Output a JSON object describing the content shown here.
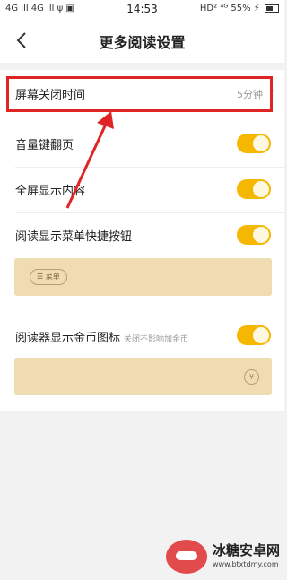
{
  "status_bar": {
    "left": "4G ıll 4G ıll ψ ▣",
    "time": "14:53",
    "right": "HD² ⁴ᴳ 55% ⚡",
    "battery_level_percent": 55
  },
  "header": {
    "title": "更多阅读设置",
    "back_icon": "chevron-left-icon"
  },
  "settings": {
    "screen_off": {
      "label": "屏幕关闭时间",
      "value": "5分钟",
      "chevron_icon": "chevron-right-icon"
    },
    "volume_keys": {
      "label": "音量键翻页",
      "enabled": true
    },
    "fullscreen": {
      "label": "全屏显示内容",
      "enabled": true
    },
    "menu_shortcut": {
      "label": "阅读显示菜单快捷按钮",
      "enabled": true,
      "preview_chip": "☰ 菜单"
    },
    "coin_icon": {
      "label": "阅读器显示金币图标",
      "hint": "关闭不影响加金币",
      "enabled": true,
      "preview_icon": "¥"
    }
  },
  "colors": {
    "toggle_on": "#f5b700",
    "highlight_border": "#e02424",
    "paper": "#efdcb2"
  },
  "watermark": {
    "title": "冰糖安卓网",
    "url": "www.btxtdmy.com"
  }
}
